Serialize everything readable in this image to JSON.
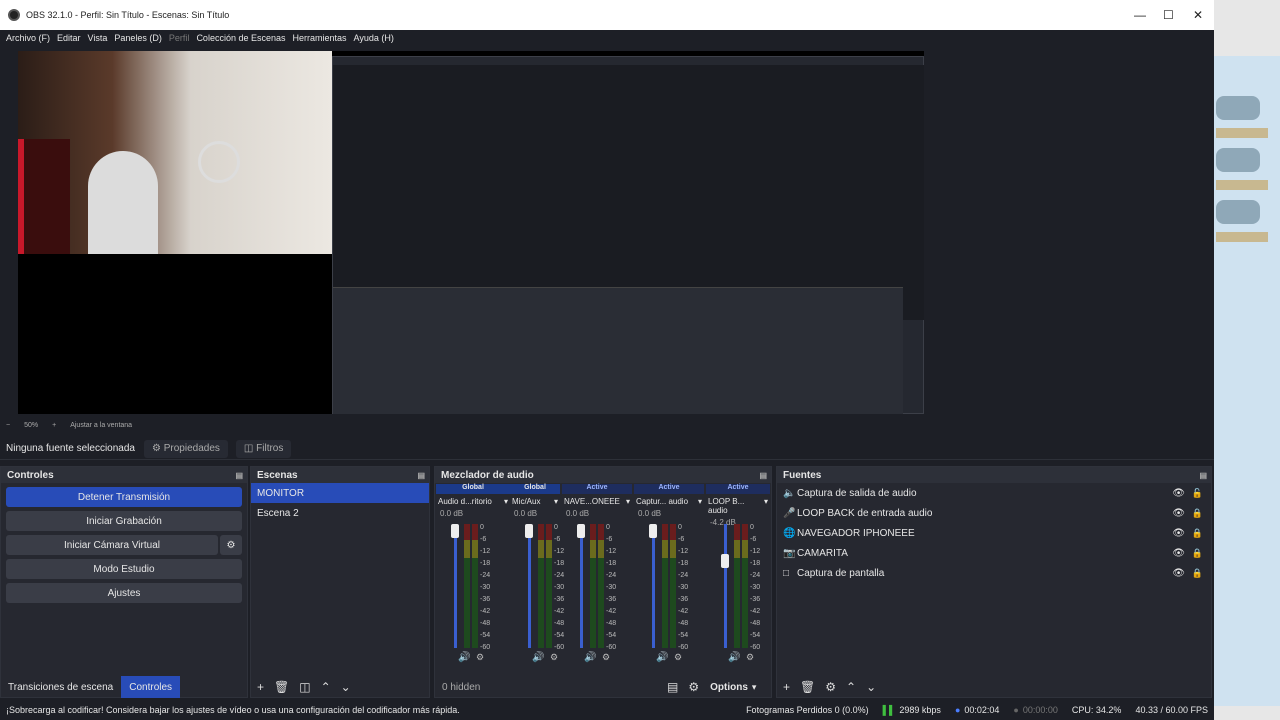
{
  "window": {
    "title": "OBS 32.1.0 - Perfil: Sin Título - Escenas: Sin Título"
  },
  "menu": [
    "Archivo (F)",
    "Editar",
    "Vista",
    "Paneles (D)",
    "Perfil",
    "Colección de Escenas",
    "Herramientas",
    "Ayuda (H)"
  ],
  "zoom": {
    "value": "50%",
    "fit": "Ajustar a la ventana"
  },
  "source_bar": {
    "no_source": "Ninguna fuente seleccionada",
    "properties": "Propiedades",
    "filters": "Filtros"
  },
  "controls": {
    "title": "Controles",
    "buttons": [
      "Detener Transmisión",
      "Iniciar Grabación",
      "Iniciar Cámara Virtual",
      "Modo Estudio",
      "Ajustes"
    ],
    "tab_transitions": "Transiciones de escena",
    "tab_controls": "Controles"
  },
  "scenes": {
    "title": "Escenas",
    "items": [
      "MONITOR",
      "Escena 2"
    ]
  },
  "mixer": {
    "title": "Mezclador de audio",
    "channels": [
      {
        "tag": "Global",
        "name": "Audio d...ritorio",
        "db": "0.0 dB"
      },
      {
        "tag": "Global",
        "name": "Mic/Aux",
        "db": "0.0 dB"
      },
      {
        "tag": "Active",
        "name": "NAVE...ONEEE",
        "db": "0.0 dB"
      },
      {
        "tag": "Active",
        "name": "Captur... audio",
        "db": "0.0 dB"
      },
      {
        "tag": "Active",
        "name": "LOOP B... audio",
        "db": "-4.2 dB"
      }
    ],
    "scale": [
      "0",
      "-6",
      "-12",
      "-18",
      "-24",
      "-30",
      "-36",
      "-42",
      "-48",
      "-54",
      "-60"
    ],
    "hidden": "0 hidden",
    "options": "Options"
  },
  "sources": {
    "title": "Fuentes",
    "items": [
      {
        "icon": "speaker-icon",
        "name": "Captura de salida de audio"
      },
      {
        "icon": "mic-icon",
        "name": "LOOP BACK de entrada audio"
      },
      {
        "icon": "browser-icon",
        "name": "NAVEGADOR IPHONEEE"
      },
      {
        "icon": "camera-icon",
        "name": "CAMARITA"
      },
      {
        "icon": "monitor-icon",
        "name": "Captura de pantalla"
      }
    ]
  },
  "status": {
    "warning": "¡Sobrecarga al codificar! Considera bajar los ajustes de vídeo o usa una configuración del codificador más rápida.",
    "dropped": "Fotogramas Perdidos 0 (0.0%)",
    "bitrate": "2989 kbps",
    "stream_time": "00:02:04",
    "rec_time": "00:00:00",
    "cpu": "CPU: 34.2%",
    "fps": "40.33 / 60.00 FPS"
  },
  "colors": {
    "accent": "#284cb8",
    "bg": "#1d1f26",
    "panel": "#262830"
  }
}
